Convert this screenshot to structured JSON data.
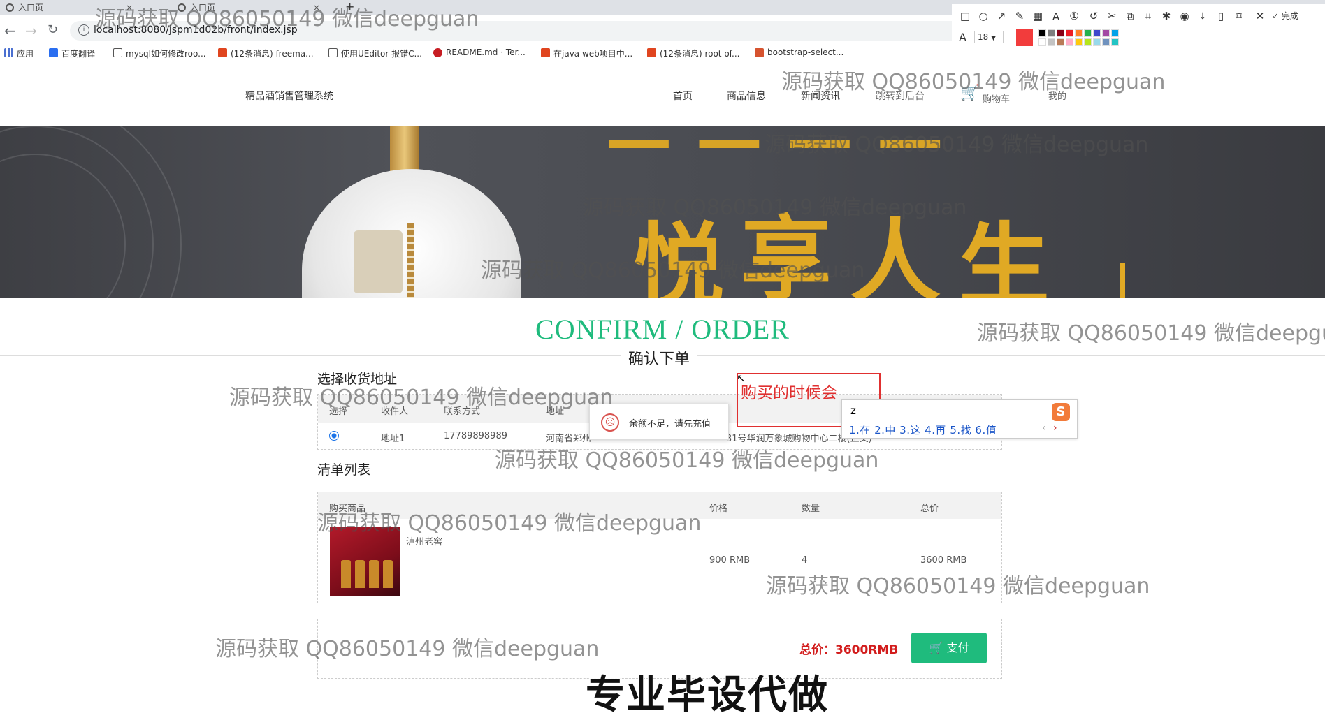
{
  "browser": {
    "tabs": [
      "入口页",
      "入口页"
    ],
    "url": "localhost:8080/jspm1d02b/front/index.jsp",
    "bookmarks": [
      {
        "label": "应用",
        "color": "#1a73e8"
      },
      {
        "label": "百度翻译",
        "color": "#2a6ef0"
      },
      {
        "label": "mysql如何修改roo...",
        "color": "#555555"
      },
      {
        "label": "(12条消息) freema...",
        "color": "#e0451f"
      },
      {
        "label": "使用UEditor 报错C...",
        "color": "#555555"
      },
      {
        "label": "README.md · Ter...",
        "color": "#c71d23"
      },
      {
        "label": "在java web项目中...",
        "color": "#e0451f"
      },
      {
        "label": "(12条消息) root of...",
        "color": "#e0451f"
      },
      {
        "label": "bootstrap-select...",
        "color": "#d6532f"
      }
    ]
  },
  "shot_toolbar": {
    "font_size": "18",
    "done_label": "完成",
    "colors": [
      "#000000",
      "#7f7f7f",
      "#880015",
      "#ed1c24",
      "#ff7f27",
      "#22b14c",
      "#3f48cc",
      "#a349a4",
      "#00a2e8",
      "#ffffff",
      "#c3c3c3",
      "#b97a57",
      "#ffaec9",
      "#ffc90e",
      "#b5e61d",
      "#99d9ea",
      "#7092be",
      "#23c4c4"
    ],
    "active_color": "#f23c3c"
  },
  "site": {
    "name": "精品酒销售管理系统",
    "nav": [
      "首页",
      "商品信息",
      "新闻资讯",
      "跳转到后台",
      "购物车",
      "我的"
    ]
  },
  "banner": {
    "chars": [
      "悦",
      "享",
      "人",
      "生"
    ]
  },
  "confirm": {
    "title_en": "CONFIRM / ORDER",
    "title_cn": "确认下单",
    "address_section": "选择收货地址",
    "address_headers": [
      "选择",
      "收件人",
      "联系方式",
      "地址"
    ],
    "address_row": {
      "name": "地址1",
      "phone": "17789898989",
      "addr_start": "河南省郑州",
      "addr_end": "31号华润万象城购物中心二楼(正文)"
    },
    "list_section": "清单列表",
    "list_headers": [
      "购买商品",
      "价格",
      "数量",
      "总价"
    ],
    "item": {
      "name": "泸州老窖",
      "price": "900 RMB",
      "qty": "4",
      "total": "3600 RMB"
    },
    "total_label": "总价：3600RMB",
    "pay_label": "支付"
  },
  "toast": "余额不足，请先充值",
  "annotation": "购买的时候会",
  "ime": {
    "input": "z",
    "candidates": "1.在  2.中  3.这  4.再  5.找  6.值"
  },
  "watermark": "源码获取 QQ86050149 微信deepguan",
  "watermark_cut": "源码获取 QQ86050149 微信deepgu",
  "caption": "专业毕设代做"
}
